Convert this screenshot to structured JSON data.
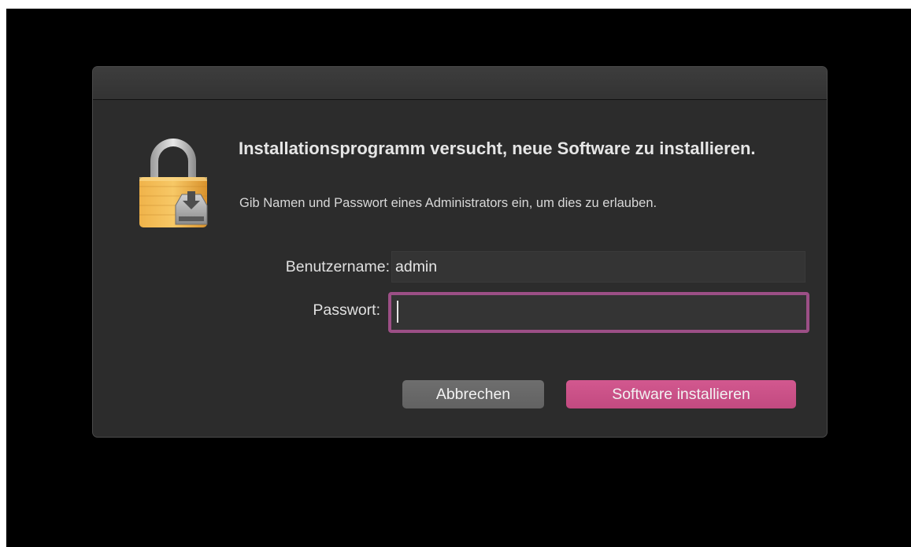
{
  "dialog": {
    "title": "Installationsprogramm versucht, neue Software zu installieren.",
    "message": "Gib Namen und Passwort eines Administrators ein, um dies zu erlauben.",
    "icon": "lock-installer-icon"
  },
  "form": {
    "username_label": "Benutzername:",
    "username_value": "admin",
    "password_label": "Passwort:",
    "password_value": ""
  },
  "buttons": {
    "cancel_label": "Abbrechen",
    "install_label": "Software installieren"
  },
  "colors": {
    "accent": "#c94f86",
    "focus_ring": "#9c4f86",
    "dialog_bg": "#2c2c2c",
    "screen_bg": "#000000"
  }
}
